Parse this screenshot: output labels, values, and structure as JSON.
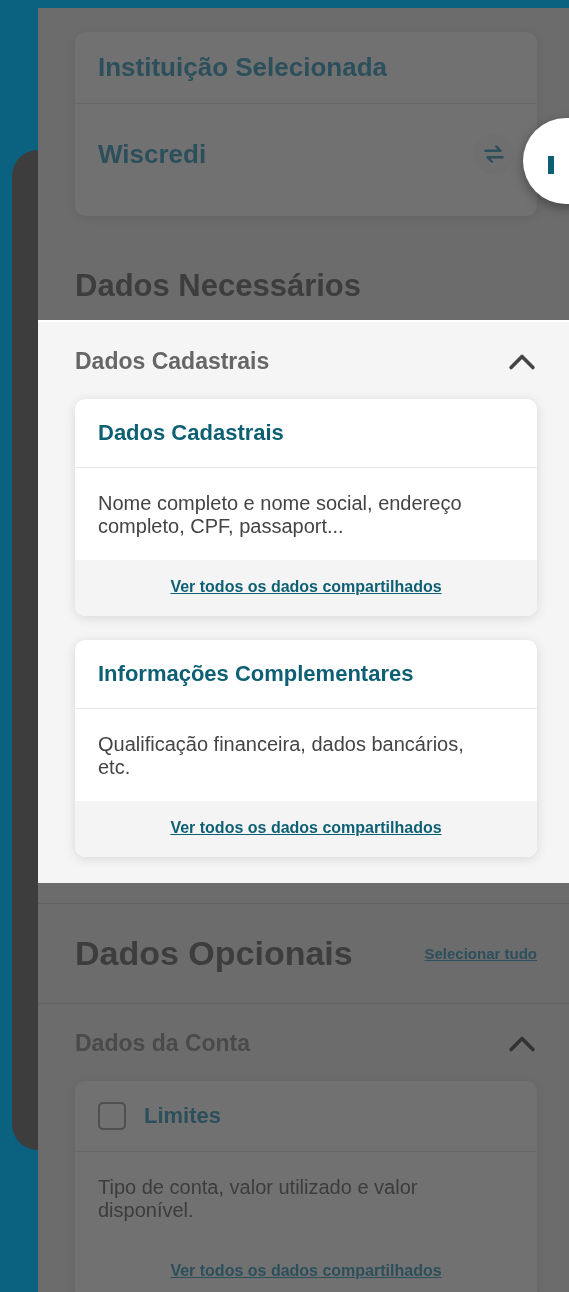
{
  "institution": {
    "heading": "Instituição Selecionada",
    "name": "Wiscredi"
  },
  "required": {
    "title": "Dados Necessários",
    "groups": [
      {
        "title": "Dados Cadastrais",
        "expanded": true,
        "highlighted": true,
        "cards": [
          {
            "kind": "plain",
            "title": "Dados Cadastrais",
            "description": "Nome completo e nome social, endereço completo, CPF, passaport...",
            "link": "Ver todos os dados compartilhados"
          },
          {
            "kind": "plain",
            "title": "Informações Complementares",
            "description": "Qualificação financeira, dados bancários, etc.",
            "link": "Ver todos os dados compartilhados"
          }
        ]
      }
    ]
  },
  "optional": {
    "title": "Dados Opcionais",
    "select_all": "Selecionar tudo",
    "groups": [
      {
        "title": "Dados da Conta",
        "expanded": true,
        "highlighted": false,
        "cards": [
          {
            "kind": "selectable",
            "checked": false,
            "title": "Limites",
            "description": "Tipo de conta, valor utilizado e valor disponível.",
            "link": "Ver todos os dados compartilhados"
          }
        ]
      }
    ]
  }
}
